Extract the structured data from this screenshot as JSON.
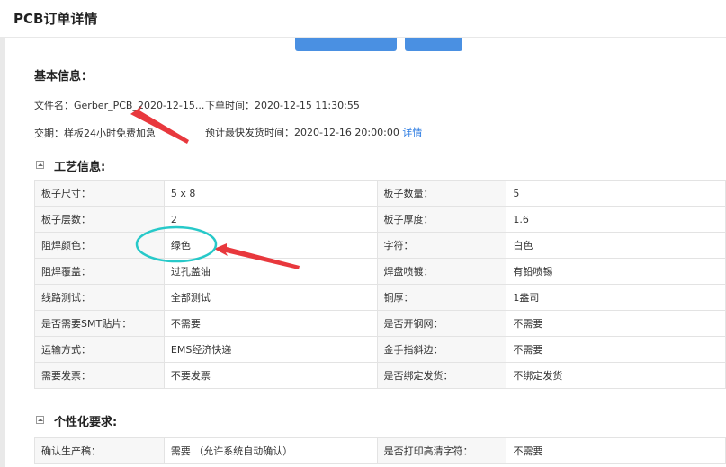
{
  "window": {
    "title": "PCB订单详情"
  },
  "basic": {
    "title": "基本信息：",
    "file_name": "文件名：Gerber_PCB_2020-12-15...",
    "order_time": "下单时间：2020-12-15 11:30:55",
    "delivery": "交期：样板24小时免费加急",
    "ship_time": "预计最快发货时间：2020-12-16 20:00:00",
    "details_link": "详情"
  },
  "process": {
    "title": "工艺信息:",
    "rows": [
      [
        "板子尺寸：",
        "5 x 8",
        "板子数量：",
        "5"
      ],
      [
        "板子层数：",
        "2",
        "板子厚度：",
        "1.6"
      ],
      [
        "阻焊颜色：",
        "绿色",
        "字符：",
        "白色"
      ],
      [
        "阻焊覆盖：",
        "过孔盖油",
        "焊盘喷镀：",
        "有铅喷锡"
      ],
      [
        "线路测试：",
        "全部测试",
        "铜厚：",
        "1盎司"
      ],
      [
        "是否需要SMT贴片：",
        "不需要",
        "是否开钢网：",
        "不需要"
      ],
      [
        "运输方式：",
        "EMS经济快递",
        "金手指斜边：",
        "不需要"
      ],
      [
        "需要发票：",
        "不要发票",
        "是否绑定发货：",
        "不绑定发货"
      ]
    ]
  },
  "custom": {
    "title": "个性化要求:",
    "rows": [
      [
        "确认生产稿：",
        "需要 （允许系统自动确认）",
        "是否打印高清字符：",
        "不需要"
      ]
    ]
  },
  "colors": {
    "accent": "#4a90e2",
    "annotation_red": "#e8383d",
    "annotation_cyan": "#27c9c9",
    "link": "#2a7ae2"
  }
}
